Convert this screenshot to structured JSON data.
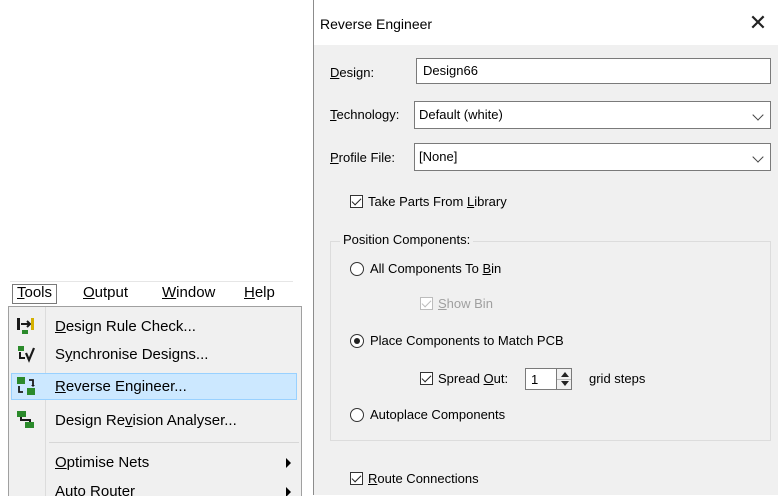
{
  "menubar": {
    "items": [
      {
        "label": "Tools",
        "u": "T",
        "rest": "ools"
      },
      {
        "label": "Output",
        "u": "O",
        "rest": "utput"
      },
      {
        "label": "Window",
        "u": "W",
        "rest": "indow"
      },
      {
        "label": "Help",
        "u": "H",
        "rest": "elp"
      }
    ]
  },
  "tools_menu": {
    "items": [
      {
        "label": "Design Rule Check...",
        "pre": "",
        "u": "D",
        "rest": "esign Rule Check...",
        "icon": "design-rule-check-icon"
      },
      {
        "label": "Synchronise Designs...",
        "pre": "S",
        "u": "y",
        "rest": "nchronise Designs...",
        "icon": "synchronise-designs-icon"
      },
      {
        "label": "Reverse Engineer...",
        "pre": "",
        "u": "R",
        "rest": "everse Engineer...",
        "icon": "reverse-engineer-icon"
      },
      {
        "label": "Design Revision Analyser...",
        "pre": "Design Re",
        "u": "v",
        "rest": "ision Analyser...",
        "icon": "design-revision-analyser-icon"
      },
      {
        "label": "Optimise Nets",
        "pre": "",
        "u": "O",
        "rest": "ptimise Nets",
        "icon": ""
      },
      {
        "label": "Auto Router",
        "pre": "",
        "u": "",
        "rest": "Auto Router",
        "icon": ""
      }
    ]
  },
  "dialog": {
    "title": "Reverse Engineer",
    "close_glyph": "✕",
    "design": {
      "label_u": "D",
      "label_rest": "esign:",
      "value": "Design66"
    },
    "technology": {
      "label_u": "T",
      "label_rest": "echnology:",
      "value": "Default (white)"
    },
    "profile": {
      "label_u": "P",
      "label_rest": "rofile File:",
      "value": "[None]"
    },
    "take_parts": {
      "pre": "Take Parts From ",
      "u": "L",
      "rest": "ibrary",
      "checked": true
    },
    "position_group": {
      "label": "Position Components:",
      "all_to_bin": {
        "pre": "All Components To ",
        "u": "B",
        "rest": "in",
        "selected": false
      },
      "show_bin": {
        "u": "S",
        "rest": "how Bin",
        "checked": true,
        "disabled": true
      },
      "match_pcb": {
        "label": "Place Components to Match PCB",
        "selected": true
      },
      "spread_out": {
        "pre": "Spread ",
        "u": "O",
        "rest": "ut:",
        "checked": true,
        "value": "1",
        "suffix": "grid steps"
      },
      "autoplace": {
        "label": "Autoplace Components",
        "selected": false
      }
    },
    "route": {
      "u": "R",
      "rest": "oute Connections",
      "checked": true
    }
  }
}
